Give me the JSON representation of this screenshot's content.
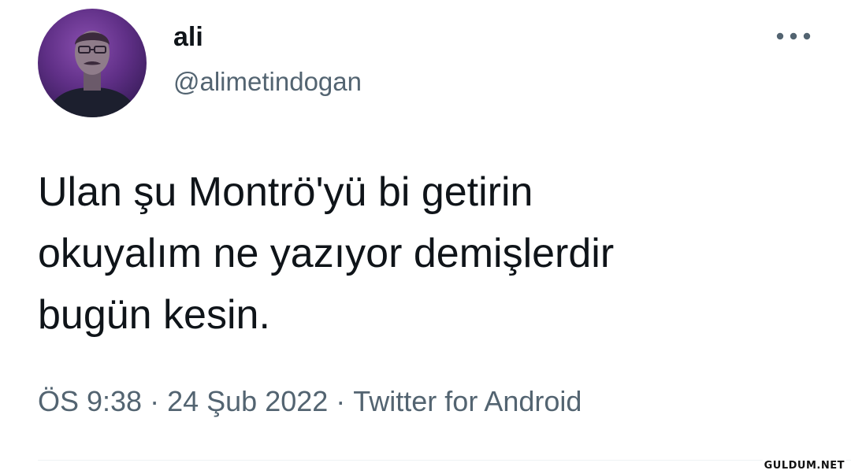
{
  "tweet": {
    "display_name": "ali",
    "handle": "@alimetindogan",
    "text": "Ulan şu Montrö'yü bi getirin\nokuyalım ne yazıyor demişlerdir\nbugün kesin.",
    "time": "ÖS 9:38",
    "date": "24 Şub 2022",
    "separator": "·",
    "source": "Twitter for Android"
  },
  "icons": {
    "more": "more-horizontal-icon",
    "avatar": "user-avatar"
  },
  "colors": {
    "text_primary": "#0f1419",
    "text_secondary": "#536471",
    "avatar_bg": "#5f2f86",
    "divider": "#eff3f4"
  },
  "watermark": "GULDUM.NET"
}
